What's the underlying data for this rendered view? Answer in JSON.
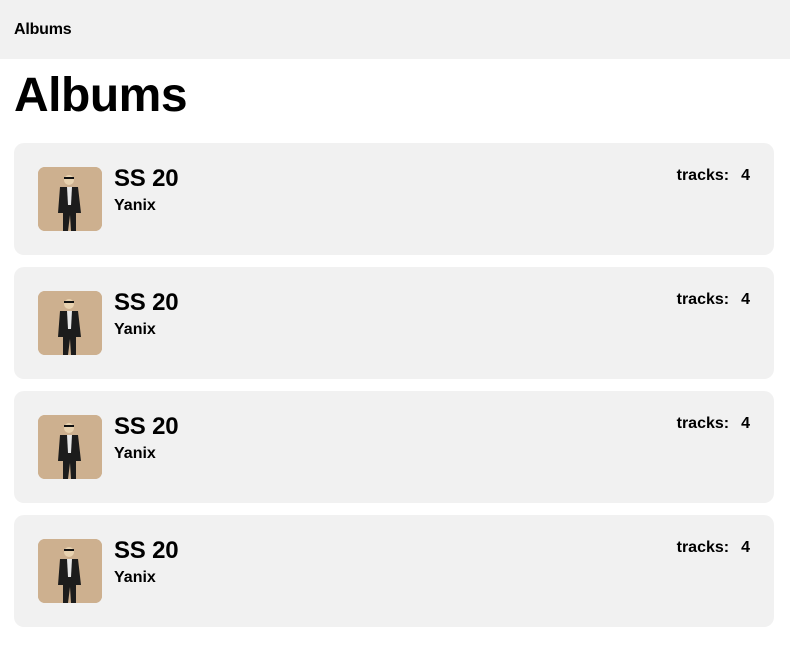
{
  "header": {
    "title": "Albums"
  },
  "page": {
    "title": "Albums"
  },
  "albums": [
    {
      "title": "SS 20",
      "artist": "Yanix",
      "tracks_label": "tracks:",
      "tracks_count": "4"
    },
    {
      "title": "SS 20",
      "artist": "Yanix",
      "tracks_label": "tracks:",
      "tracks_count": "4"
    },
    {
      "title": "SS 20",
      "artist": "Yanix",
      "tracks_label": "tracks:",
      "tracks_count": "4"
    },
    {
      "title": "SS 20",
      "artist": "Yanix",
      "tracks_label": "tracks:",
      "tracks_count": "4"
    }
  ],
  "colors": {
    "card_bg": "#f1f1f1",
    "header_bg": "#f1f1f1",
    "cover_bg": "#cdb08f"
  }
}
